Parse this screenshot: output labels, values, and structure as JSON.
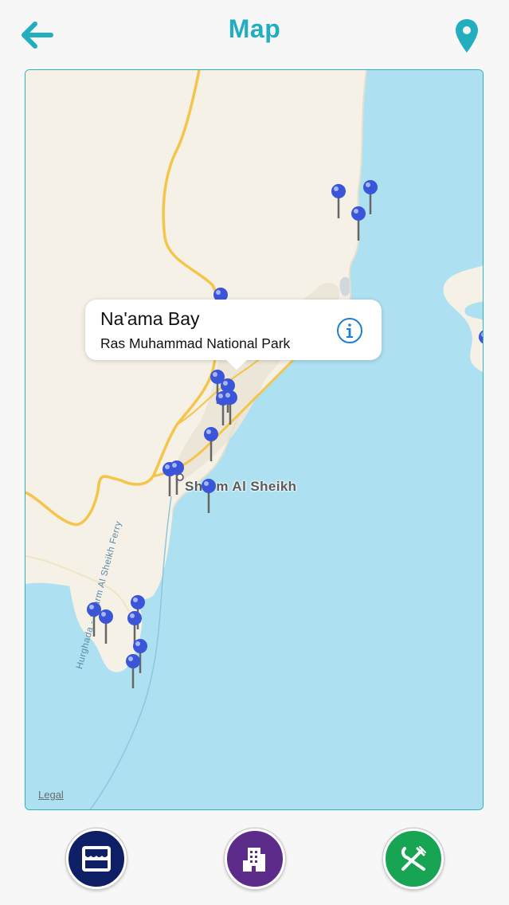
{
  "header": {
    "title": "Map",
    "back_icon": "back-arrow-icon",
    "location_icon": "location-pin-icon",
    "accent_color": "#21aebf"
  },
  "map": {
    "place_label": "Sharm Al Sheikh",
    "ferry_label": "Hurghada - Sharm Al Sheikh Ferry",
    "legal_label": "Legal",
    "water_color": "#ade0f1",
    "land_color": "#f5f1e6",
    "road_color": "#f4c54a",
    "pin_color": "#3a55d8",
    "pin_count": 26,
    "callout": {
      "title": "Na'ama Bay",
      "subtitle": "Ras Muhammad National Park",
      "info_icon": "info-icon"
    }
  },
  "tabbar": {
    "buttons": [
      {
        "name": "shops",
        "icon": "storefront-icon",
        "color": "#0f1f66"
      },
      {
        "name": "hotels",
        "icon": "building-icon",
        "color": "#5b2c8a"
      },
      {
        "name": "restaurants",
        "icon": "fork-knife-icon",
        "color": "#17a453"
      }
    ]
  }
}
